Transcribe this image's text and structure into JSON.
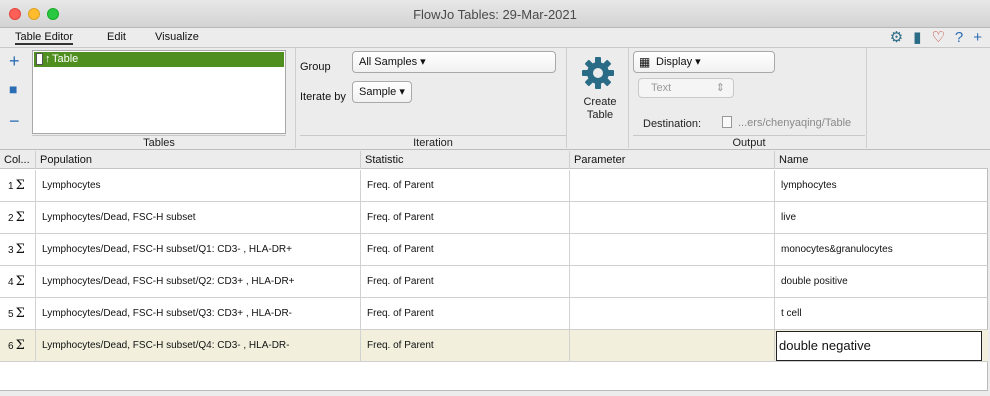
{
  "window": {
    "title": "FlowJo Tables: 29-Mar-2021"
  },
  "menu": [
    "Table Editor",
    "Edit",
    "Visualize"
  ],
  "top_icons": [
    "gear-icon",
    "bookmark-icon",
    "heart-icon",
    "help-icon",
    "plus-icon"
  ],
  "tables": {
    "section_label": "Tables",
    "items": [
      {
        "label": "Table"
      }
    ]
  },
  "iteration": {
    "section_label": "Iteration",
    "group_label": "Group",
    "group_value": "All Samples ▾",
    "iterate_label": "Iterate by",
    "iterate_value": "Sample ▾"
  },
  "output": {
    "section_label": "Output",
    "create_label_1": "Create",
    "create_label_2": "Table",
    "display_value": "Display ▾",
    "format_value": "Text",
    "destination_label": "Destination:",
    "destination_path": "...ers/chenyaqing/Table"
  },
  "grid": {
    "columns": [
      "Col...",
      "Population",
      "Statistic",
      "Parameter",
      "Name"
    ],
    "rows": [
      {
        "index": "1",
        "population": "Lymphocytes",
        "statistic": "Freq. of Parent",
        "parameter": "",
        "name": "lymphocytes"
      },
      {
        "index": "2",
        "population": "Lymphocytes/Dead, FSC-H subset",
        "statistic": "Freq. of Parent",
        "parameter": "",
        "name": "live"
      },
      {
        "index": "3",
        "population": "Lymphocytes/Dead, FSC-H subset/Q1: CD3- , HLA-DR+",
        "statistic": "Freq. of Parent",
        "parameter": "",
        "name": "monocytes&granulocytes"
      },
      {
        "index": "4",
        "population": "Lymphocytes/Dead, FSC-H subset/Q2: CD3+ , HLA-DR+",
        "statistic": "Freq. of Parent",
        "parameter": "",
        "name": "double positive"
      },
      {
        "index": "5",
        "population": "Lymphocytes/Dead, FSC-H subset/Q3: CD3+ , HLA-DR-",
        "statistic": "Freq. of Parent",
        "parameter": "",
        "name": "t cell"
      },
      {
        "index": "6",
        "population": "Lymphocytes/Dead, FSC-H subset/Q4: CD3- , HLA-DR-",
        "statistic": "Freq. of Parent",
        "parameter": "",
        "name": "double negative"
      }
    ]
  }
}
